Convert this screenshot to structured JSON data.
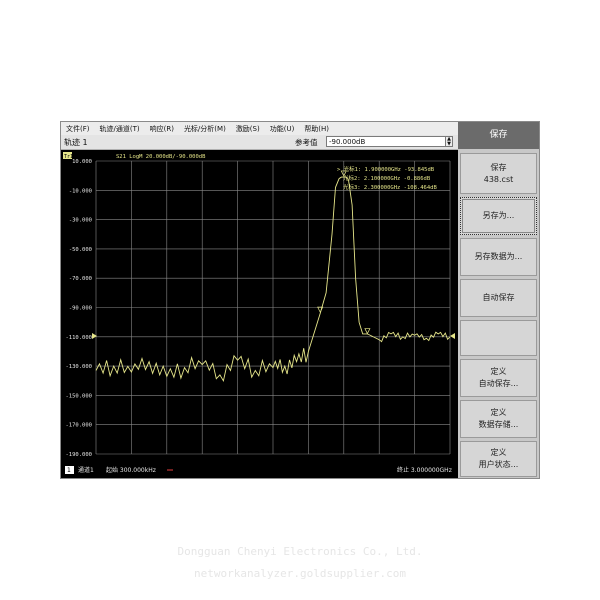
{
  "menu": [
    "文件(F)",
    "轨迹/通道(T)",
    "响应(R)",
    "光标/分析(M)",
    "激励(S)",
    "功能(U)",
    "帮助(H)"
  ],
  "toolbar": {
    "trace": "轨迹 1",
    "ref_label": "参考值",
    "ref_value": "-90.000dB"
  },
  "screen": {
    "trace_header": "Tr1",
    "trace_info": "S21 LogM 20.000dB/-90.000dB",
    "y_ticks": [
      "10.000",
      "-10.000",
      "-30.000",
      "-50.000",
      "-70.000",
      "-90.000",
      "-110.000",
      "-130.000",
      "-150.000",
      "-170.000",
      "-190.000"
    ],
    "markers": [
      "> 光标1: 1.900000GHz -93.845dB",
      "光标2: 2.100000GHz -0.886dB",
      "光标3: 2.300000GHz -108.464dB"
    ],
    "footer": {
      "channel_num": "1",
      "channel": "通道1",
      "start": "起始 300.000kHz",
      "stop": "终止 3.000000GHz"
    }
  },
  "softkeys": {
    "title": "保存",
    "save": "保存",
    "save_file": "438.cst",
    "save_as": "另存为...",
    "save_data_as": "另存数据为...",
    "auto_save": "自动保存",
    "define_auto_1": "定义",
    "define_auto_2": "自动保存...",
    "define_data_1": "定义",
    "define_data_2": "数据存储...",
    "define_user_1": "定义",
    "define_user_2": "用户状态..."
  },
  "watermark": {
    "line1": "Dongguan Chenyi Electronics Co., Ltd.",
    "line2": "networkanalyzer.goldsupplier.com"
  },
  "colors": {
    "trace": "#e6e68a",
    "grid": "#8a8a8a",
    "screen_bg": "#000000",
    "header_bg": "#6b6b6b"
  },
  "chart_data": {
    "type": "line",
    "x_unit": "GHz",
    "xlim": [
      0.0003,
      3.0
    ],
    "ylim": [
      -190,
      10
    ],
    "y_ref": -90,
    "y_scale_per_div": 20,
    "series": [
      {
        "x": [
          0.0003,
          0.15,
          0.3,
          0.45,
          0.6,
          0.75,
          0.9,
          1.05,
          1.2,
          1.35,
          1.5,
          1.6,
          1.7,
          1.8,
          1.9,
          1.95,
          2.0,
          2.03,
          2.06,
          2.08,
          2.12,
          2.14,
          2.17,
          2.2,
          2.23,
          2.26,
          2.3,
          2.4,
          2.5,
          2.6,
          2.7,
          2.8,
          2.9,
          3.0
        ],
        "y": [
          -133,
          -130,
          -134,
          -127,
          -137,
          -131,
          -129,
          -136,
          -126,
          -133,
          -131,
          -130,
          -127,
          -120,
          -94,
          -80,
          -40,
          -8,
          -2,
          -1,
          -1,
          -3,
          -20,
          -70,
          -100,
          -108,
          -108,
          -112,
          -108,
          -110,
          -109,
          -111,
          -108,
          -110
        ]
      }
    ]
  }
}
